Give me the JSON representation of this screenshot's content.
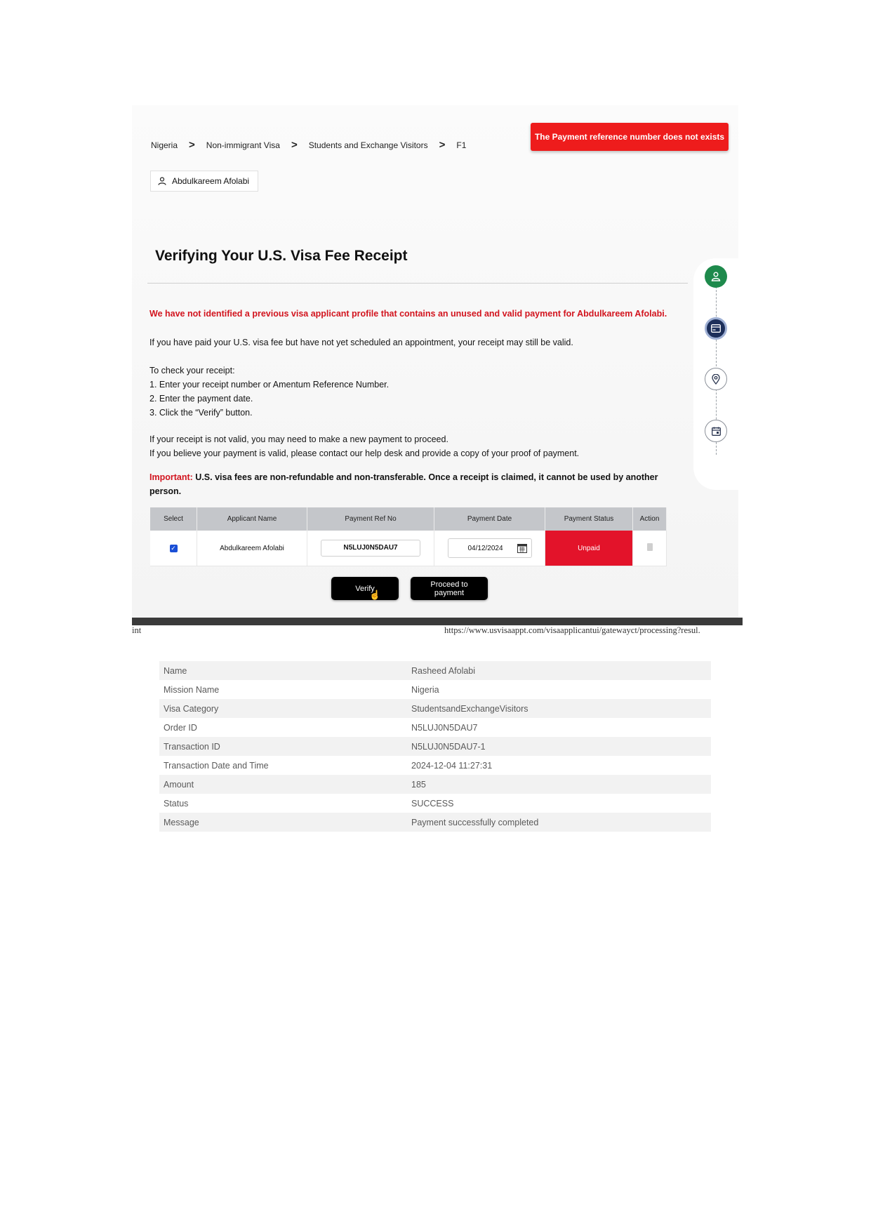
{
  "breadcrumb": [
    "Nigeria",
    "Non-immigrant Visa",
    "Students and Exchange Visitors",
    "F1"
  ],
  "breadcrumb_separator": ">",
  "user_name": "Abdulkareem Afolabi",
  "toast_message": "The Payment reference number does not exists",
  "page_title": "Verifying Your U.S. Visa Fee Receipt",
  "warning_message": "We have not identified a previous visa applicant profile that contains an unused and valid payment for Abdulkareem Afolabi.",
  "paragraph_paid": "If you have paid your U.S. visa fee but have not yet scheduled an appointment, your receipt may still be valid.",
  "check_heading": "To check your receipt:",
  "check_steps": [
    "1. Enter your receipt number or Amentum Reference Number.",
    "2. Enter the payment date.",
    "3. Click the “Verify” button."
  ],
  "invalid_line": "If your receipt is not valid, you may need to make a new payment to proceed.",
  "helpdesk_line": "If you believe your payment is valid, please contact our help desk and provide a copy of your proof of payment.",
  "important_label": "Important:",
  "important_text": "U.S. visa fees are non-refundable and non-transferable. Once a receipt is claimed, it cannot be used by another person.",
  "table": {
    "headers": [
      "Select",
      "Applicant Name",
      "Payment Ref No",
      "Payment Date",
      "Payment Status",
      "Action"
    ],
    "row": {
      "selected": true,
      "applicant_name": "Abdulkareem Afolabi",
      "payment_ref": "N5LUJ0N5DAU7",
      "payment_date": "04/12/2024",
      "payment_status": "Unpaid"
    }
  },
  "buttons": {
    "verify": "Verify",
    "proceed": "Proceed to payment"
  },
  "footer": {
    "left_fragment": "int",
    "url": "https://www.usvisaappt.com/visaapplicantui/gatewayct/processing?resul."
  },
  "transaction": [
    {
      "label": "Name",
      "value": "Rasheed Afolabi"
    },
    {
      "label": "Mission Name",
      "value": "Nigeria"
    },
    {
      "label": "Visa Category",
      "value": "StudentsandExchangeVisitors"
    },
    {
      "label": "Order ID",
      "value": "N5LUJ0N5DAU7"
    },
    {
      "label": "Transaction ID",
      "value": "N5LUJ0N5DAU7-1"
    },
    {
      "label": "Transaction Date and Time",
      "value": "2024-12-04 11:27:31"
    },
    {
      "label": "Amount",
      "value": "185"
    },
    {
      "label": "Status",
      "value": "SUCCESS"
    },
    {
      "label": "Message",
      "value": "Payment successfully completed"
    }
  ],
  "colors": {
    "toast": "#ee1c1c",
    "warning_text": "#d2141e",
    "unpaid": "#e3132a",
    "step_active": "#1e8a4c",
    "step_current": "#1d2f5a"
  },
  "steps": [
    {
      "icon": "user-icon",
      "state": "complete"
    },
    {
      "icon": "card-icon",
      "state": "current"
    },
    {
      "icon": "location-pin-icon",
      "state": "upcoming"
    },
    {
      "icon": "calendar-icon",
      "state": "upcoming"
    }
  ]
}
